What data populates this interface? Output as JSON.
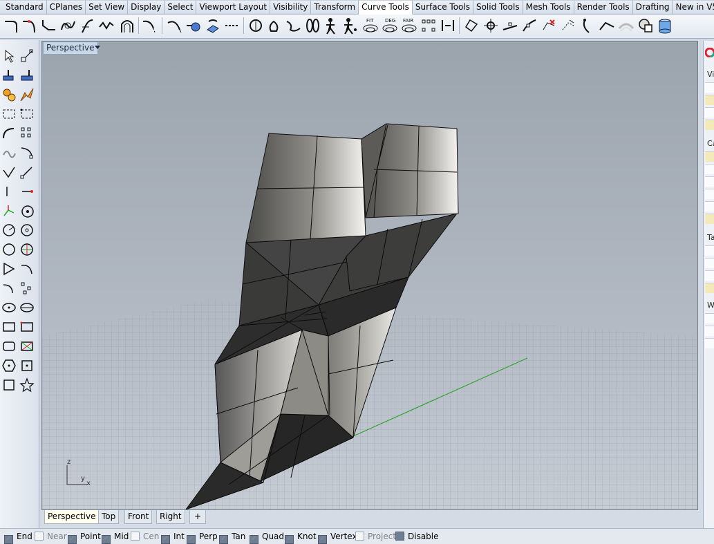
{
  "ribbon_tabs": [
    "Standard",
    "CPlanes",
    "Set View",
    "Display",
    "Select",
    "Viewport Layout",
    "Visibility",
    "Transform",
    "Curve Tools",
    "Surface Tools",
    "Solid Tools",
    "Mesh Tools",
    "Render Tools",
    "Drafting",
    "New in V5"
  ],
  "active_ribbon_tab": "Curve Tools",
  "ribbon_labels": {
    "fit": "FIT",
    "deg": "DEG",
    "fair": "FAIR"
  },
  "viewport": {
    "title": "Perspective",
    "axes": {
      "z": "z",
      "y": "y",
      "x": "x"
    }
  },
  "viewport_tabs": [
    "Perspective",
    "Top",
    "Front",
    "Right"
  ],
  "active_viewport_tab": "Perspective",
  "add_viewport_symbol": "+",
  "osnaps": [
    {
      "label": "End",
      "checked": true
    },
    {
      "label": "Near",
      "checked": false
    },
    {
      "label": "Point",
      "checked": true
    },
    {
      "label": "Mid",
      "checked": true
    },
    {
      "label": "Cen",
      "checked": false
    },
    {
      "label": "Int",
      "checked": true
    },
    {
      "label": "Perp",
      "checked": true
    },
    {
      "label": "Tan",
      "checked": true
    },
    {
      "label": "Quad",
      "checked": true
    },
    {
      "label": "Knot",
      "checked": true
    },
    {
      "label": "Vertex",
      "checked": true
    },
    {
      "label": "Project",
      "checked": false
    },
    {
      "label": "Disable",
      "checked": false
    }
  ],
  "right_panel_labels": [
    "Vi",
    "Ca",
    "Ta",
    "W"
  ],
  "colors": {
    "accent": "#ffffff",
    "grid": "#8d939b",
    "green_axis": "#2fa12f",
    "red_axis": "#b63a3a",
    "mesh_dark": "#2b2b2b",
    "mesh_light": "#c8c6c2"
  }
}
